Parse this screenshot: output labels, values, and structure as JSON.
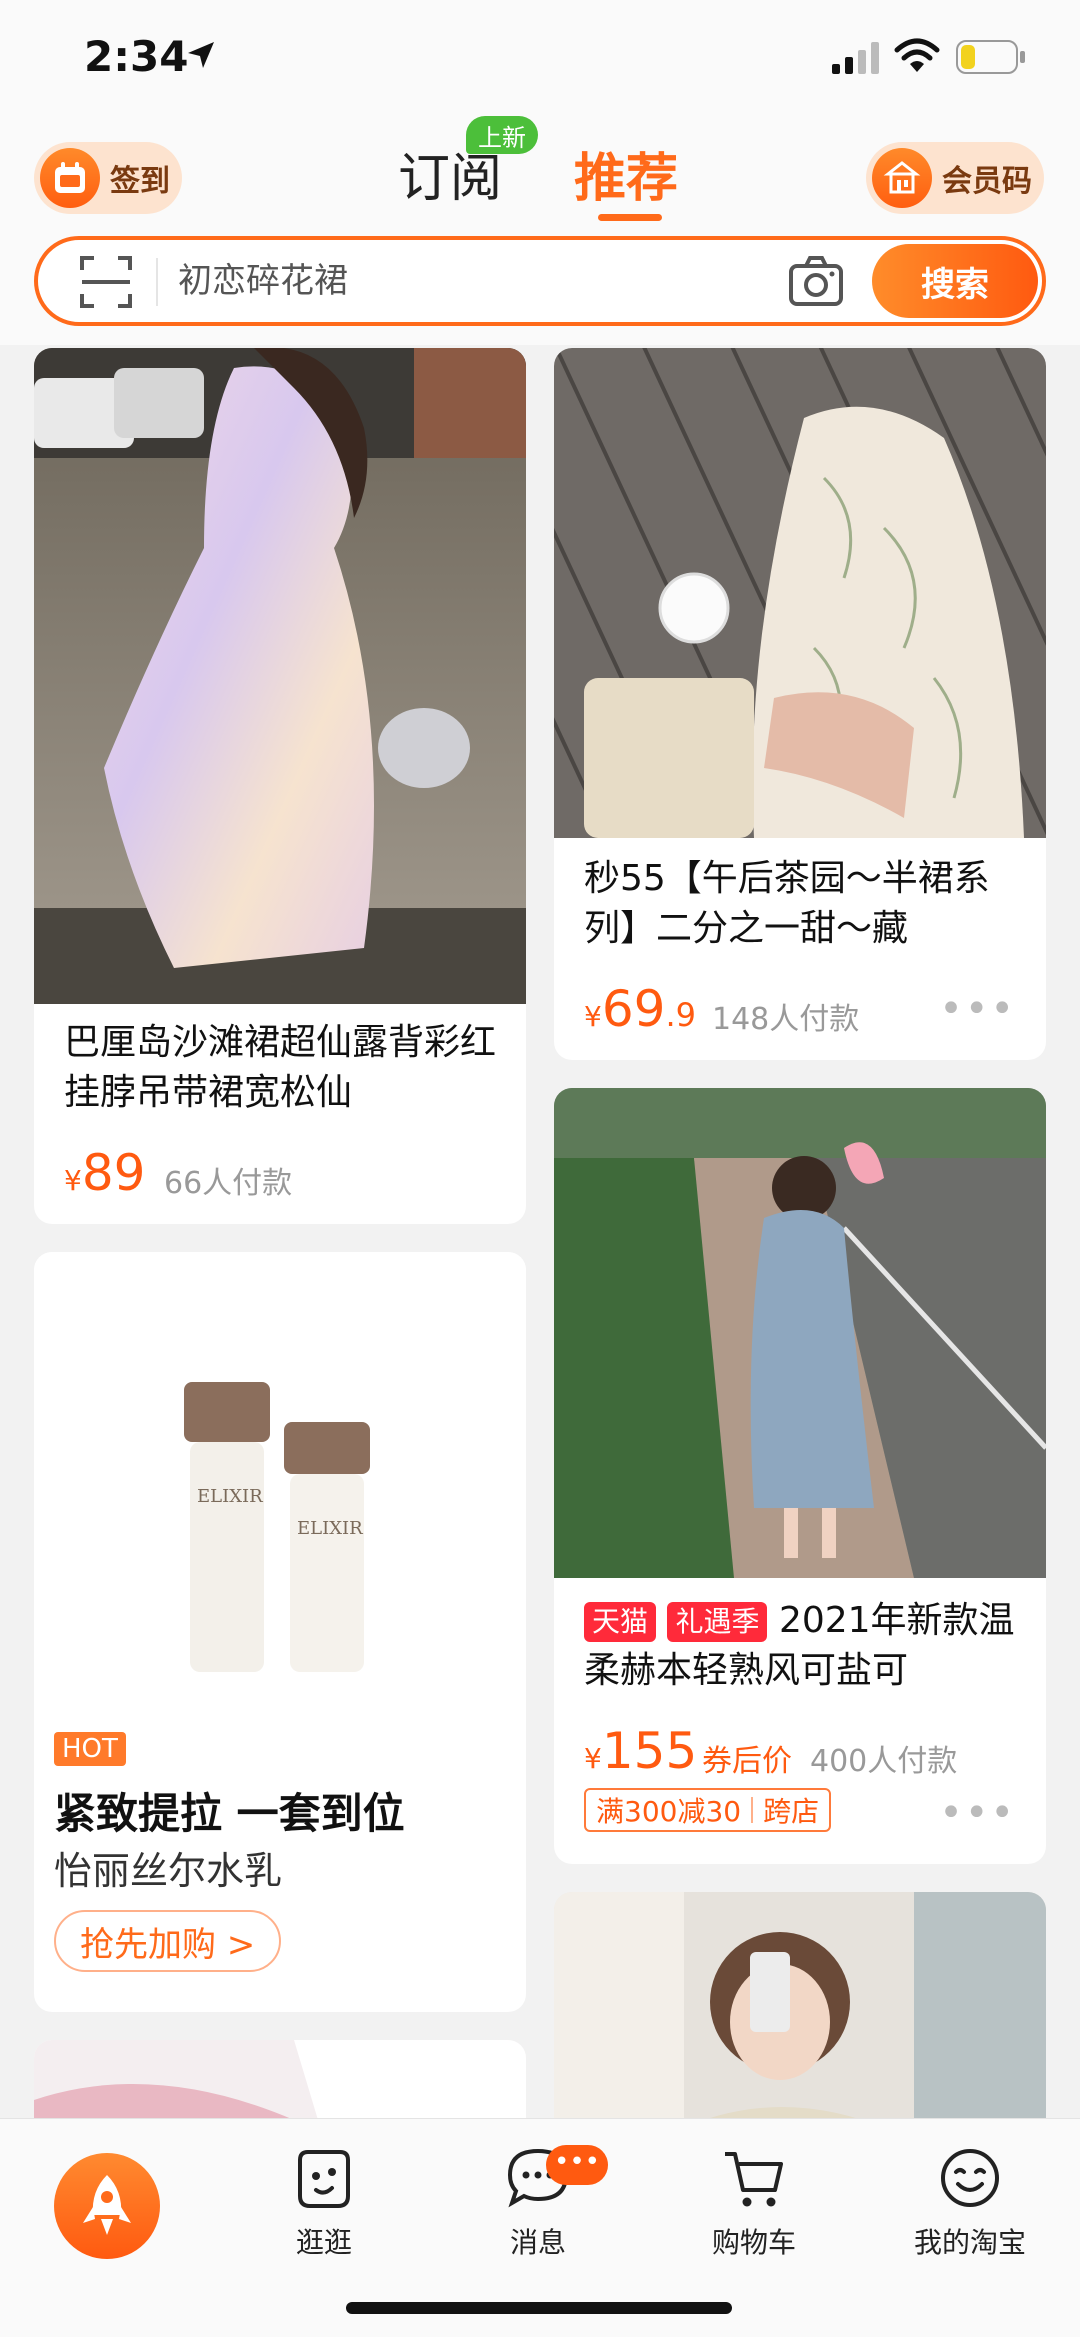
{
  "status_bar": {
    "time": "2:34"
  },
  "header": {
    "checkin_label": "签到",
    "member_code_label": "会员码",
    "tabs": [
      {
        "label": "订阅",
        "active": false,
        "badge": "上新"
      },
      {
        "label": "推荐",
        "active": true
      }
    ],
    "accent_color": "#ff6a1a"
  },
  "search": {
    "placeholder": "初恋碎花裙",
    "button_label": "搜索"
  },
  "feed": {
    "left": [
      {
        "title": "巴厘岛沙滩裙超仙露背彩红挂脖吊带裙宽松仙",
        "price_symbol": "¥",
        "price_int": "89",
        "price_dec": "",
        "buyers": "66人付款"
      },
      {
        "type": "ad",
        "badge": "HOT",
        "image_text": "ELIXIR",
        "headline": "紧致提拉 一套到位",
        "subtitle": "怡丽丝尔水乳",
        "cta": "抢先加购 >"
      }
    ],
    "right": [
      {
        "title": "秒55【午后茶园～半裙系列】二分之一甜～藏",
        "price_symbol": "¥",
        "price_int": "69",
        "price_dec": ".9",
        "buyers": "148人付款",
        "more": "•••"
      },
      {
        "tags": [
          "天猫",
          "礼遇季"
        ],
        "title": "2021年新款温柔赫本轻熟风可盐可",
        "price_symbol": "¥",
        "price_int": "155",
        "price_dec": "",
        "coupon_label": "券后价",
        "buyers": "400人付款",
        "promo": [
          "满300减30",
          "跨店"
        ],
        "more": "•••"
      }
    ]
  },
  "bottom_nav": {
    "items": [
      {
        "label": "逛逛",
        "icon": "stroll-icon"
      },
      {
        "label": "消息",
        "icon": "message-icon",
        "badge": "•••"
      },
      {
        "label": "购物车",
        "icon": "cart-icon"
      },
      {
        "label": "我的淘宝",
        "icon": "profile-icon"
      }
    ]
  }
}
